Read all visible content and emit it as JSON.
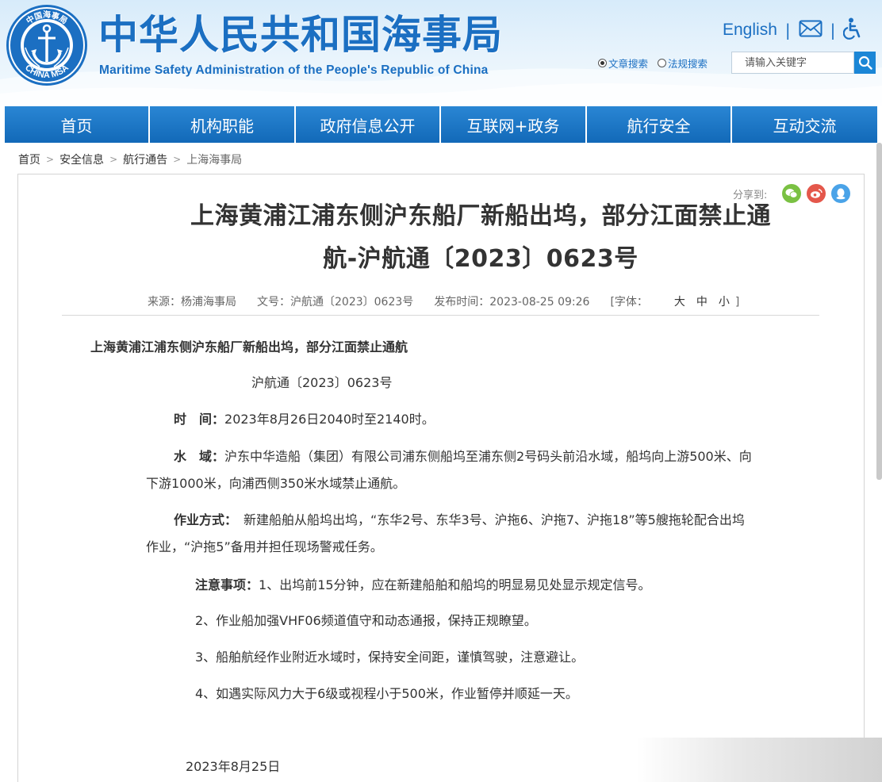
{
  "header": {
    "title_cn": "中华人民共和国海事局",
    "title_en": "Maritime Safety Administration of the People's Republic of China",
    "logo_text_top": "中国海事局",
    "logo_text_bottom": "CHINA MSA",
    "lang_link": "English",
    "mail_icon": "mail-icon",
    "accessibility_icon": "accessibility-icon",
    "search": {
      "option_article": "文章搜索",
      "option_law": "法规搜索",
      "selected": "文章搜索",
      "placeholder": "请输入关键字",
      "button_icon": "search-icon"
    }
  },
  "nav": {
    "items": [
      {
        "label": "首页"
      },
      {
        "label": "机构职能"
      },
      {
        "label": "政府信息公开"
      },
      {
        "label": "互联网+政务"
      },
      {
        "label": "航行安全"
      },
      {
        "label": "互动交流"
      }
    ]
  },
  "breadcrumb": {
    "items": [
      "首页",
      "安全信息",
      "航行通告"
    ],
    "current": "上海海事局",
    "separator": ">"
  },
  "share": {
    "label": "分享到:",
    "icons": [
      "wechat-icon",
      "weibo-icon",
      "qq-icon"
    ],
    "colors": {
      "wechat": "#7ac143",
      "weibo": "#e4574b",
      "qq": "#4aa3e8"
    }
  },
  "article": {
    "title_line1": "上海黄浦江浦东侧沪东船厂新船出坞，部分江面禁止通",
    "title_line2": "航-沪航通〔2023〕0623号",
    "meta": {
      "source": "来源：杨浦海事局",
      "doc_no": "文号：沪航通〔2023〕0623号",
      "publish_time": "发布时间：2023-08-25 09:26",
      "font_label": "[字体：",
      "font_large": "大",
      "font_medium": "中",
      "font_small": "小",
      "font_close": "]"
    },
    "heading": "上海黄浦江浦东侧沪东船厂新船出坞，部分江面禁止通航",
    "doc_number": "沪航通〔2023〕0623号",
    "time_label": "时　间：",
    "time_value": "2023年8月26日2040时至2140时。",
    "area_label": "水　域：",
    "area_value_line1": "沪东中华造船（集团）有限公司浦东侧船坞至浦东侧2号码头前沿水域，船坞向上游500米、向",
    "area_value_line2": "下游1000米，向浦西侧350米水域禁止通航。",
    "method_label": "作业方式：",
    "method_value_line1": "新建船舶从船坞出坞，“东华2号、东华3号、沪拖6、沪拖7、沪拖18”等5艘拖轮配合出坞",
    "method_value_line2": "作业，“沪拖5”备用并担任现场警戒任务。",
    "notes_label": "注意事项：",
    "note1": "1、出坞前15分钟，应在新建船舶和船坞的明显易见处显示规定信号。",
    "note2": "2、作业船加强VHF06频道值守和动态通报，保持正规瞭望。",
    "note3": "3、船舶航经作业附近水域时，保持安全间距，谨慎驾驶，注意避让。",
    "note4": "4、如遇实际风力大于6级或视程小于500米，作业暂停并顺延一天。",
    "date": "2023年8月25日"
  },
  "colors": {
    "brand_blue": "#1b6fc2",
    "nav_blue": "#1672c4",
    "search_button": "#1b86d6"
  }
}
